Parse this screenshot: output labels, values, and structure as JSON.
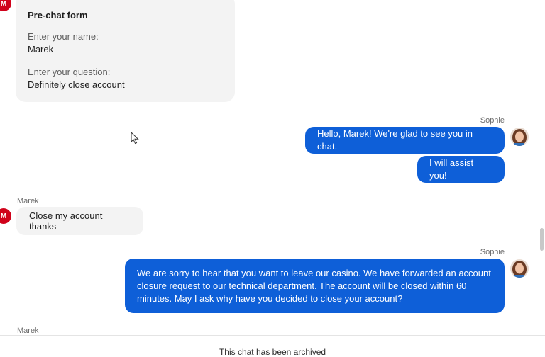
{
  "prechat_form": {
    "avatar_initial": "M",
    "title": "Pre-chat form",
    "name_label": "Enter your name:",
    "name_value": "Marek",
    "question_label": "Enter your question:",
    "question_value": "Definitely close account"
  },
  "messages": [
    {
      "sender": "Sophie",
      "text": "Hello, Marek! We're glad to see you in chat."
    },
    {
      "text": "I will assist you!"
    },
    {
      "sender": "Marek",
      "avatar_initial": "M",
      "text": "Close my account thanks"
    },
    {
      "sender": "Sophie",
      "text": "We are sorry to hear that you want to leave our casino. We have forwarded an account closure request to our technical department. The account will be closed within 60 minutes. May I ask why have you decided to close your account?"
    },
    {
      "sender": "Marek"
    }
  ],
  "footer": {
    "note": "This chat has been archived"
  },
  "colors": {
    "agent_bubble": "#0e5fd8",
    "visitor_bubble": "#f3f3f3",
    "visitor_avatar": "#d0021b"
  }
}
